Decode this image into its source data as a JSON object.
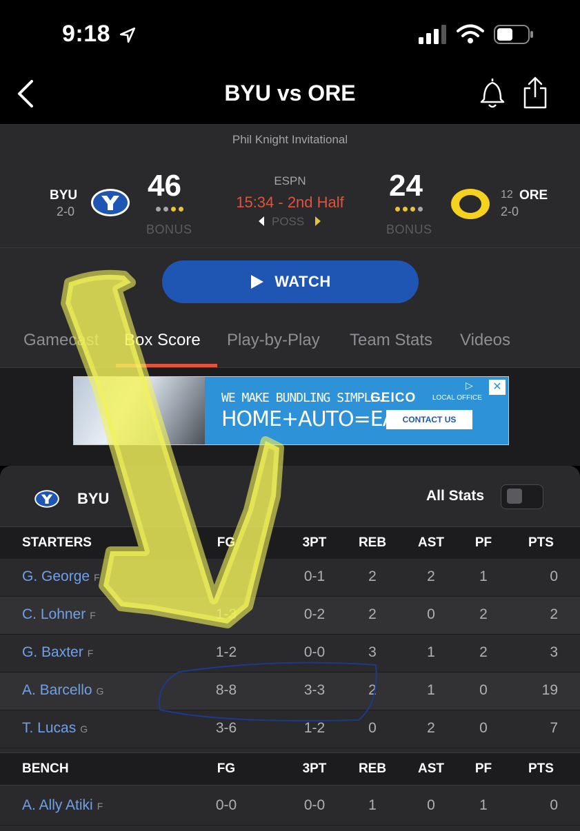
{
  "status_bar": {
    "time": "9:18"
  },
  "nav": {
    "title": "BYU vs ORE"
  },
  "event": {
    "name": "Phil Knight Invitational"
  },
  "game": {
    "away": {
      "abbr": "BYU",
      "record": "2-0",
      "score": "46",
      "bonus": "BONUS",
      "logo_color": "#1f56b3"
    },
    "home": {
      "abbr": "ORE",
      "rank": "12",
      "record": "2-0",
      "score": "24",
      "bonus": "BONUS",
      "logo_color": "#f5d21f"
    },
    "network": "ESPN",
    "clock": "15:34 - 2nd Half",
    "possession": "POSS"
  },
  "watch": {
    "label": "WATCH"
  },
  "tabs": [
    {
      "label": "Gamecast"
    },
    {
      "label": "Box Score"
    },
    {
      "label": "Play-by-Play"
    },
    {
      "label": "Team Stats"
    },
    {
      "label": "Videos"
    }
  ],
  "ad": {
    "line1": "WE MAKE BUNDLING SIMPLE.",
    "line2": "HOME+AUTO=EASY",
    "brand": "GEICO",
    "brand_sub": "LOCAL OFFICE",
    "cta": "CONTACT US"
  },
  "box_score": {
    "team": "BYU",
    "all_stats_label": "All Stats",
    "starters_header": [
      "STARTERS",
      "FG",
      "3PT",
      "REB",
      "AST",
      "PF",
      "PTS"
    ],
    "starters": [
      {
        "name": "G. George",
        "pos": "F",
        "fg": "",
        "tp": "0-1",
        "reb": "2",
        "ast": "2",
        "pf": "1",
        "pts": "0"
      },
      {
        "name": "C. Lohner",
        "pos": "F",
        "fg": "1-3",
        "tp": "0-2",
        "reb": "2",
        "ast": "0",
        "pf": "2",
        "pts": "2"
      },
      {
        "name": "G. Baxter",
        "pos": "F",
        "fg": "1-2",
        "tp": "0-0",
        "reb": "3",
        "ast": "1",
        "pf": "2",
        "pts": "3"
      },
      {
        "name": "A. Barcello",
        "pos": "G",
        "fg": "8-8",
        "tp": "3-3",
        "reb": "2",
        "ast": "1",
        "pf": "0",
        "pts": "19"
      },
      {
        "name": "T. Lucas",
        "pos": "G",
        "fg": "3-6",
        "tp": "1-2",
        "reb": "0",
        "ast": "2",
        "pf": "0",
        "pts": "7"
      }
    ],
    "bench_header": [
      "BENCH",
      "FG",
      "3PT",
      "REB",
      "AST",
      "PF",
      "PTS"
    ],
    "bench": [
      {
        "name": "A. Ally Atiki",
        "pos": "F",
        "fg": "0-0",
        "tp": "0-0",
        "reb": "1",
        "ast": "0",
        "pf": "1",
        "pts": "0"
      }
    ]
  },
  "colors": {
    "accent": "#e0533d",
    "link": "#6fa0e8",
    "watch": "#1f56b3",
    "highlight": "#f2f25a"
  }
}
